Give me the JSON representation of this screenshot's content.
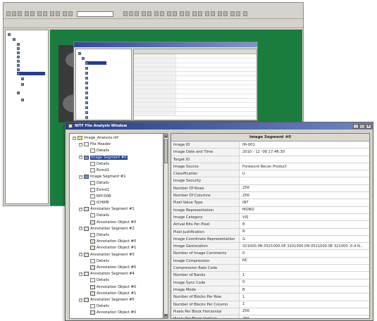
{
  "front_window": {
    "title": "NITF File Analysis Window",
    "controls": {
      "minimize": "_",
      "maximize": "□",
      "close": "x"
    }
  },
  "tree": {
    "nodes": [
      {
        "label": "Image_Analysis.ntf",
        "icon": "folder-icon",
        "level": 0,
        "expander": "−"
      },
      {
        "label": "File Header",
        "icon": "detail-icon",
        "level": 1,
        "expander": "−"
      },
      {
        "label": "Details",
        "icon": "detail-icon",
        "level": 2,
        "expander": ""
      },
      {
        "label": "Image Segment #0",
        "icon": "image-icon",
        "level": 1,
        "expander": "−",
        "selected": true
      },
      {
        "label": "Details",
        "icon": "detail-icon",
        "level": 2,
        "expander": ""
      },
      {
        "label": "Exmd1",
        "icon": "detail-icon",
        "level": 2,
        "expander": ""
      },
      {
        "label": "Image Segment #1",
        "icon": "image-icon",
        "level": 1,
        "expander": "−"
      },
      {
        "label": "Details",
        "icon": "detail-icon",
        "level": 2,
        "expander": ""
      },
      {
        "label": "Exmd1",
        "icon": "detail-icon",
        "level": 2,
        "expander": ""
      },
      {
        "label": "RPC00B",
        "icon": "detail-icon",
        "level": 2,
        "expander": ""
      },
      {
        "label": "ICHIPB",
        "icon": "detail-icon",
        "level": 2,
        "expander": ""
      },
      {
        "label": "Annotation Segment #1",
        "icon": "annotation-icon",
        "level": 1,
        "expander": "−"
      },
      {
        "label": "Details",
        "icon": "detail-icon",
        "level": 2,
        "expander": ""
      },
      {
        "label": "Annotation Object #0",
        "icon": "annotation-icon",
        "level": 2,
        "expander": ""
      },
      {
        "label": "Annotation Segment #2",
        "icon": "annotation-icon",
        "level": 1,
        "expander": "−"
      },
      {
        "label": "Details",
        "icon": "detail-icon",
        "level": 2,
        "expander": ""
      },
      {
        "label": "Annotation Object #0",
        "icon": "annotation-icon",
        "level": 2,
        "expander": ""
      },
      {
        "label": "Annotation Object #1",
        "icon": "annotation-icon",
        "level": 2,
        "expander": ""
      },
      {
        "label": "Annotation Segment #3",
        "icon": "annotation-icon",
        "level": 1,
        "expander": "−"
      },
      {
        "label": "Details",
        "icon": "detail-icon",
        "level": 2,
        "expander": ""
      },
      {
        "label": "Annotation Object #0",
        "icon": "annotation-icon",
        "level": 2,
        "expander": ""
      },
      {
        "label": "Annotation Segment #4",
        "icon": "annotation-icon",
        "level": 1,
        "expander": "−"
      },
      {
        "label": "Details",
        "icon": "detail-icon",
        "level": 2,
        "expander": ""
      },
      {
        "label": "Annotation Object #0",
        "icon": "annotation-icon",
        "level": 2,
        "expander": ""
      },
      {
        "label": "Annotation Object #1",
        "icon": "annotation-icon",
        "level": 2,
        "expander": ""
      },
      {
        "label": "Annotation Segment #5",
        "icon": "annotation-icon",
        "level": 1,
        "expander": "−"
      },
      {
        "label": "Details",
        "icon": "detail-icon",
        "level": 2,
        "expander": ""
      },
      {
        "label": "Annotation Object #0",
        "icon": "annotation-icon",
        "level": 2,
        "expander": ""
      }
    ]
  },
  "grid": {
    "header": "Image Segment #0",
    "rows": [
      {
        "key": "Image ID",
        "value": "IM-001"
      },
      {
        "key": "Image Date and Time",
        "value": "2010 - 12 -08 17:46:30"
      },
      {
        "key": "Target ID",
        "value": ""
      },
      {
        "key": "Image Source",
        "value": "Foreword Recon Product"
      },
      {
        "key": "Classification",
        "value": "U"
      },
      {
        "key": "Image Security",
        "value": ""
      },
      {
        "key": "Number Of Rows",
        "value": "256"
      },
      {
        "key": "Number Of Columns",
        "value": "256"
      },
      {
        "key": "Pixel Value Type",
        "value": "INT"
      },
      {
        "key": "Image Representation",
        "value": "MONO"
      },
      {
        "key": "Image Category",
        "value": "VIS"
      },
      {
        "key": "Actual Bits Per Pixel",
        "value": "8"
      },
      {
        "key": "Pixel Justification",
        "value": "R"
      },
      {
        "key": "Image Coordinate Representation",
        "value": "G"
      },
      {
        "key": "Image Geolocation",
        "value": "321000.0N 0521000.0E 3201000.0N 0521000.0E 321000 -0.4 N..."
      },
      {
        "key": "Number of Image Comments",
        "value": "0"
      },
      {
        "key": "Image Compression",
        "value": "NC"
      },
      {
        "key": "Compression Rate Code",
        "value": ""
      },
      {
        "key": "Number of Bands",
        "value": "1"
      },
      {
        "key": "Image Sync Code",
        "value": "0"
      },
      {
        "key": "Image Mode",
        "value": "B"
      },
      {
        "key": "Number of Blocks Per Row",
        "value": "1"
      },
      {
        "key": "Number of Blocks Per Column",
        "value": "1"
      },
      {
        "key": "Pixels Per Block Horizontal",
        "value": "256"
      },
      {
        "key": "Pixels Per Block Vertical",
        "value": "256"
      }
    ]
  },
  "colors": {
    "canvas_green": "#1a7d3d",
    "titlebar_blue": "#233f8c",
    "selection_blue": "#1f3f9a",
    "window_face": "#d4d1ca"
  }
}
